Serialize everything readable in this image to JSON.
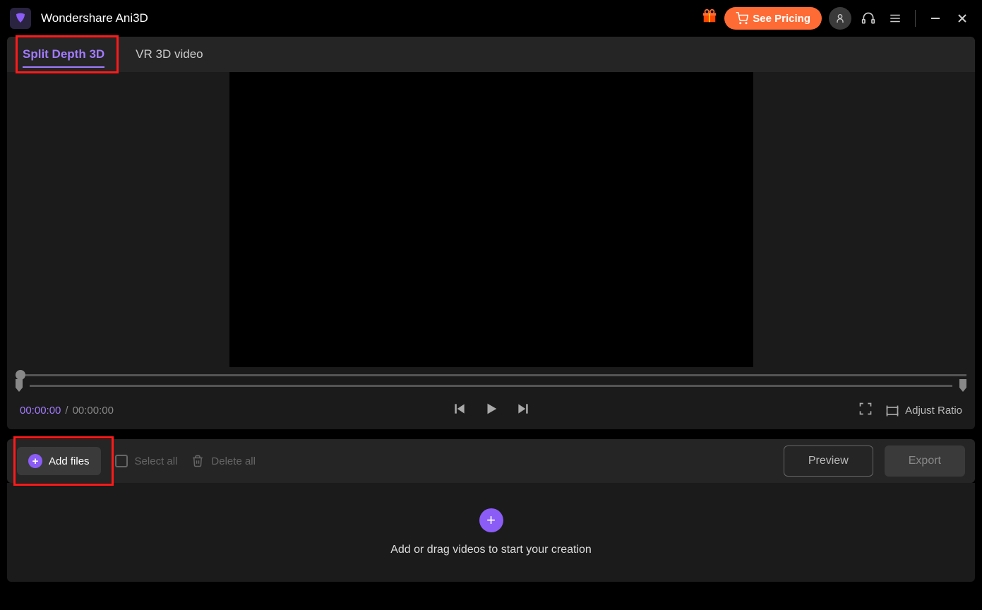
{
  "app": {
    "title": "Wondershare Ani3D"
  },
  "header": {
    "see_pricing": "See Pricing"
  },
  "tabs": [
    {
      "label": "Split Depth 3D",
      "active": true
    },
    {
      "label": "VR 3D video",
      "active": false
    }
  ],
  "player": {
    "time_current": "00:00:00",
    "time_separator": "/",
    "time_total": "00:00:00",
    "adjust_ratio": "Adjust Ratio"
  },
  "toolbar": {
    "add_files": "Add files",
    "select_all": "Select all",
    "delete_all": "Delete all",
    "preview": "Preview",
    "export": "Export"
  },
  "drop": {
    "hint": "Add or drag videos to start your creation"
  }
}
